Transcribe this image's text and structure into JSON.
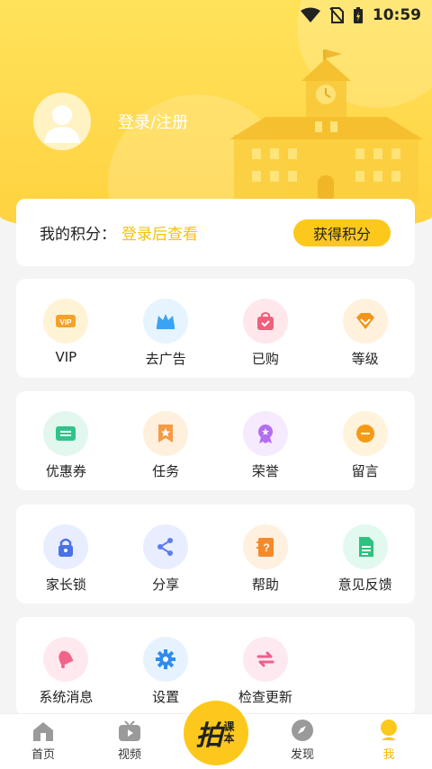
{
  "status": {
    "time": "10:59"
  },
  "profile": {
    "login_text": "登录/注册"
  },
  "points": {
    "label": "我的积分：",
    "value": "登录后查看",
    "button": "获得积分"
  },
  "grid1": [
    {
      "label": "VIP",
      "icon": "vip-icon",
      "bg": "#fff3d6",
      "color": "#f5a22a"
    },
    {
      "label": "去广告",
      "icon": "crown-icon",
      "bg": "#e6f4ff",
      "color": "#3aa3f3"
    },
    {
      "label": "已购",
      "icon": "bag-icon",
      "bg": "#ffe7ec",
      "color": "#f0607b"
    },
    {
      "label": "等级",
      "icon": "diamond-icon",
      "bg": "#fff1dc",
      "color": "#f3941b"
    }
  ],
  "grid2": [
    {
      "label": "优惠券",
      "icon": "coupon-icon",
      "bg": "#e2f8ef",
      "color": "#2ec48a"
    },
    {
      "label": "任务",
      "icon": "bookmark-star-icon",
      "bg": "#fff0dd",
      "color": "#f59b45"
    },
    {
      "label": "荣誉",
      "icon": "medal-icon",
      "bg": "#f6eaff",
      "color": "#b36ef0"
    },
    {
      "label": "留言",
      "icon": "chat-icon",
      "bg": "#fff3dc",
      "color": "#f59a18"
    }
  ],
  "grid3": [
    {
      "label": "家长锁",
      "icon": "lock-icon",
      "bg": "#e8eeff",
      "color": "#4a71e6"
    },
    {
      "label": "分享",
      "icon": "share-icon",
      "bg": "#e8eeff",
      "color": "#5c7df0"
    },
    {
      "label": "帮助",
      "icon": "help-book-icon",
      "bg": "#fff0e0",
      "color": "#f38b2d"
    },
    {
      "label": "意见反馈",
      "icon": "document-icon",
      "bg": "#e1f9ee",
      "color": "#2ec27e"
    }
  ],
  "grid4": [
    {
      "label": "系统消息",
      "icon": "bell-icon",
      "bg": "#ffe9ef",
      "color": "#f2638a"
    },
    {
      "label": "设置",
      "icon": "gear-icon",
      "bg": "#e6f3ff",
      "color": "#2f8cf0"
    },
    {
      "label": "检查更新",
      "icon": "refresh-arrows-icon",
      "bg": "#ffe9f1",
      "color": "#ef5d8f"
    }
  ],
  "tabs": [
    {
      "label": "首页",
      "icon": "home-icon"
    },
    {
      "label": "视频",
      "icon": "tv-icon"
    },
    {
      "label": "",
      "icon": "center-logo"
    },
    {
      "label": "发现",
      "icon": "compass-icon"
    },
    {
      "label": "我",
      "icon": "profile-icon",
      "active": true
    }
  ],
  "center_logo": {
    "big": "拍",
    "small": "课本"
  },
  "colors": {
    "accent": "#fcc81b",
    "header": "#ffd84a",
    "highlight": "#f6c20c"
  }
}
